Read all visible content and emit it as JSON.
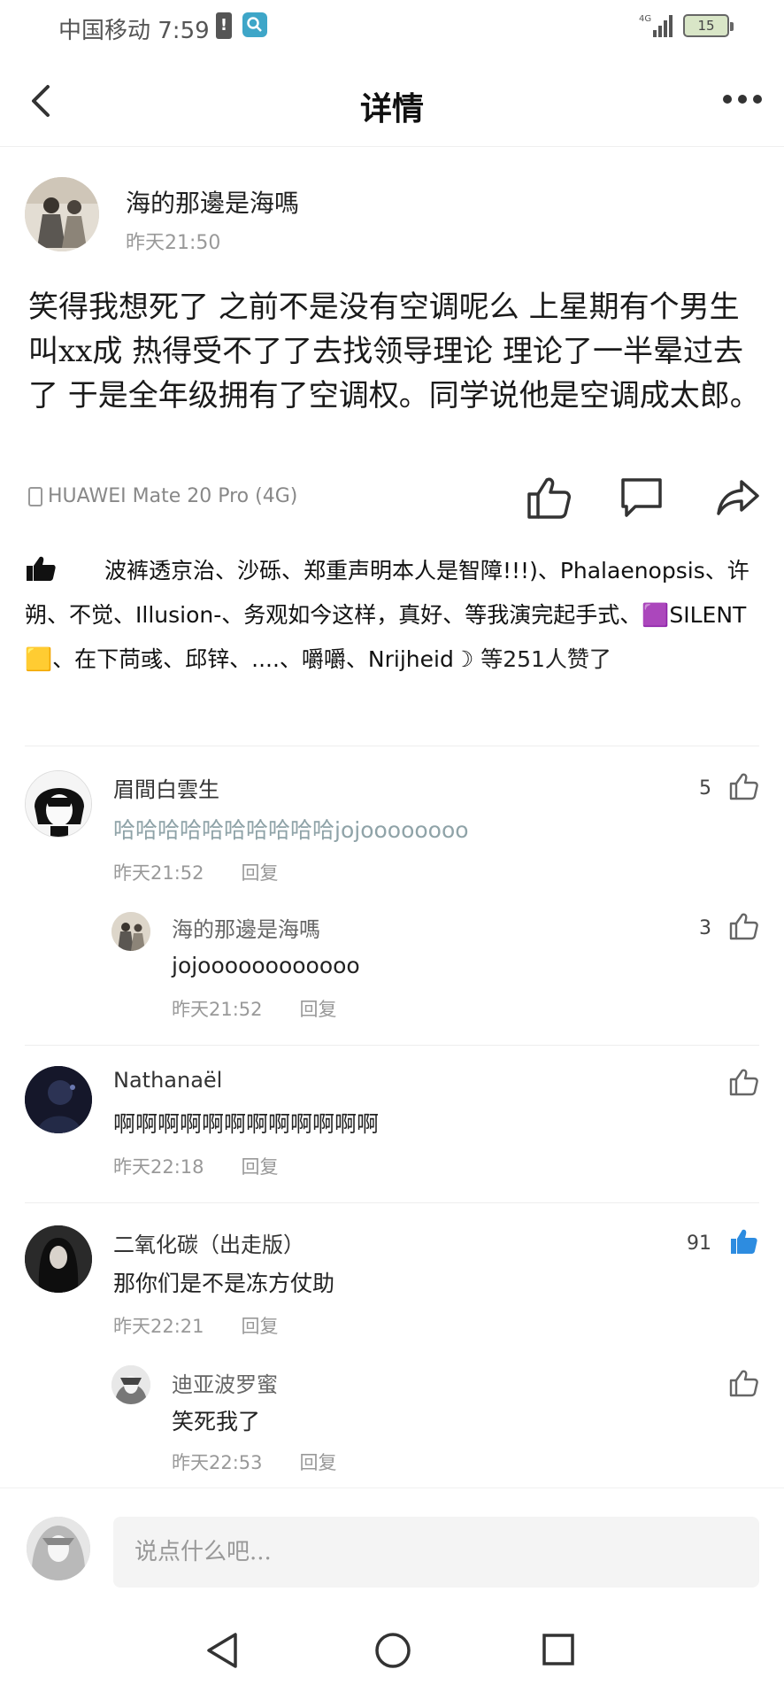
{
  "status_bar": {
    "carrier_time": "中国移动 7:59",
    "network": "4G",
    "battery": "15"
  },
  "header": {
    "title": "详情",
    "back_icon": "chevron-left-icon",
    "more_icon": "more-dots-icon"
  },
  "post": {
    "author": "海的那邊是海嗎",
    "time": "昨天21:50",
    "content": "笑得我想死了 之前不是没有空调呢么 上星期有个男生叫xx成 热得受不了了去找领导理论 理论了一半晕过去了 于是全年级拥有了空调权。同学说他是空调成太郎。",
    "device": "HUAWEI Mate 20 Pro (4G)",
    "likes": {
      "names": "波裤透京治、沙砾、郑重声明本人是智障!!!)、Phalaenopsis、许朔、不觉、Illusion-、务观如今这样，真好、等我演完起手式、🟪SILENT🟨、在下苘彧、邱锌、....、嚼嚼、Nrijheid☽",
      "suffix": " 等251人赞了"
    }
  },
  "comments": [
    {
      "name": "眉間白雲生",
      "text": "哈哈哈哈哈哈哈哈哈哈jojoooooooo",
      "time": "昨天21:52",
      "reply": "回复",
      "count": "5",
      "replies": [
        {
          "name": "海的那邊是海嗎",
          "text": "jojoooooooooooo",
          "time": "昨天21:52",
          "reply": "回复",
          "count": "3"
        }
      ]
    },
    {
      "name": "Nathanaël",
      "text": "啊啊啊啊啊啊啊啊啊啊啊啊",
      "time": "昨天22:18",
      "reply": "回复",
      "count": ""
    },
    {
      "name": "二氧化碳（出走版）",
      "text": "那你们是不是冻方仗助",
      "time": "昨天22:21",
      "reply": "回复",
      "count": "91",
      "liked": true,
      "replies": [
        {
          "name": "迪亚波罗蜜",
          "text": "笑死我了",
          "time": "昨天22:53",
          "reply": "回复",
          "count": ""
        }
      ]
    }
  ],
  "input": {
    "placeholder": "说点什么吧..."
  },
  "colors": {
    "liked_blue": "#2d8ce0",
    "meta_gray": "#999999"
  }
}
